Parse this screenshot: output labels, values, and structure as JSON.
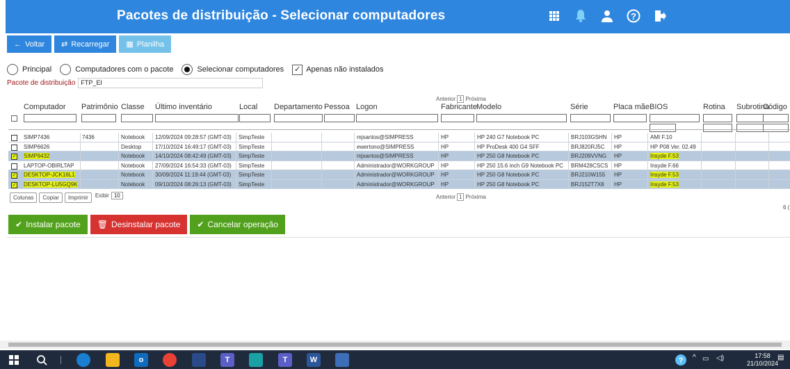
{
  "header": {
    "title": "Pacotes de distribuição - Selecionar computadores",
    "icons": [
      "grid-icon",
      "bell-icon",
      "user-icon",
      "help-icon",
      "logout-icon"
    ]
  },
  "toolbar": {
    "back_label": "Voltar",
    "reload_label": "Recarregar",
    "sheet_label": "Planilha"
  },
  "filters": {
    "radio_principal": "Principal",
    "radio_with_package": "Computadores com o pacote",
    "radio_select": "Selecionar computadores",
    "only_not_installed": "Apenas não instalados"
  },
  "package": {
    "label": "Pacote de distribuição",
    "value": "FTP_EI"
  },
  "pager": {
    "prev": "Anterior",
    "page": "1",
    "next": "Próxima"
  },
  "columns": [
    "Computador",
    "Patrimônio",
    "Classe",
    "Último inventário",
    "Local",
    "Departamento",
    "Pessoa",
    "Logon",
    "Fabricante",
    "Modelo",
    "Série",
    "Placa mãe",
    "BIOS",
    "Rotina",
    "Subrotina",
    "Código"
  ],
  "rows": [
    {
      "computer": "SIMP7436",
      "asset": "7436",
      "class": "Notebook",
      "inventory": "12/09/2024 09:28:57 (GMT-03)",
      "local": "SimpTeste",
      "logon": "mjsantos@SIMPRESS",
      "maker": "HP",
      "model": "HP 240 G7 Notebook PC",
      "serial": "BRJ103GSHN",
      "board": "HP",
      "bios": "AMI F.10",
      "checked": false
    },
    {
      "computer": "SIMP6626",
      "asset": "",
      "class": "Desktop",
      "inventory": "17/10/2024 16:49:17 (GMT-03)",
      "local": "SimpTeste",
      "logon": "ewertono@SIMPRESS",
      "maker": "HP",
      "model": "HP ProDesk 400 G4 SFF",
      "serial": "BRJ820RJ5C",
      "board": "HP",
      "bios": "HP P08 Ver. 02.49",
      "checked": false
    },
    {
      "computer": "SIMP9432",
      "asset": "",
      "class": "Notebook",
      "inventory": "14/10/2024 08:42:49 (GMT-03)",
      "local": "SimpTeste",
      "logon": "mjsantos@SIMPRESS",
      "maker": "HP",
      "model": "HP 250 G8 Notebook PC",
      "serial": "BRJ209VVNG",
      "board": "HP",
      "bios": "Insyde F.53",
      "checked": true
    },
    {
      "computer": "LAPTOP-OBIRLTAP",
      "asset": "",
      "class": "Notebook",
      "inventory": "27/09/2024 16:54:33 (GMT-03)",
      "local": "SimpTeste",
      "logon": "Administrador@WORKGROUP",
      "maker": "HP",
      "model": "HP 250 15.6 inch G9 Notebook PC",
      "serial": "BRM428CSCS",
      "board": "HP",
      "bios": "Insyde F.66",
      "checked": false
    },
    {
      "computer": "DESKTOP-JCK16L1",
      "asset": "",
      "class": "Notebook",
      "inventory": "30/09/2024 11:19:44 (GMT-03)",
      "local": "SimpTeste",
      "logon": "Administrador@WORKGROUP",
      "maker": "HP",
      "model": "HP 250 G8 Notebook PC",
      "serial": "BRJ210W155",
      "board": "HP",
      "bios": "Insyde F.53",
      "checked": true
    },
    {
      "computer": "DESKTOP-LU5GQ9K",
      "asset": "",
      "class": "Notebook",
      "inventory": "09/10/2024 08:26:13 (GMT-03)",
      "local": "SimpTeste",
      "logon": "Administrador@WORKGROUP",
      "maker": "HP",
      "model": "HP 250 G8 Notebook PC",
      "serial": "BRJ152T7X8",
      "board": "HP",
      "bios": "Insyde F.53",
      "checked": true
    }
  ],
  "table_tools": {
    "columns_btn": "Colunas",
    "copy_btn": "Copiar",
    "print_btn": "Imprimir",
    "show_label": "Exibir",
    "show_value": "10",
    "count_fragment": "6 ("
  },
  "actions": {
    "install": "Instalar pacote",
    "uninstall": "Desinstalar pacote",
    "cancel": "Cancelar operação"
  },
  "taskbar": {
    "time": "17:58",
    "date": "21/10/2024"
  },
  "colors": {
    "header_blue": "#2e86de",
    "button_light": "#74c2ea",
    "green": "#52a11c",
    "red": "#d63230",
    "highlight": "#e4f20d",
    "row_selected": "#b7c9dc"
  }
}
